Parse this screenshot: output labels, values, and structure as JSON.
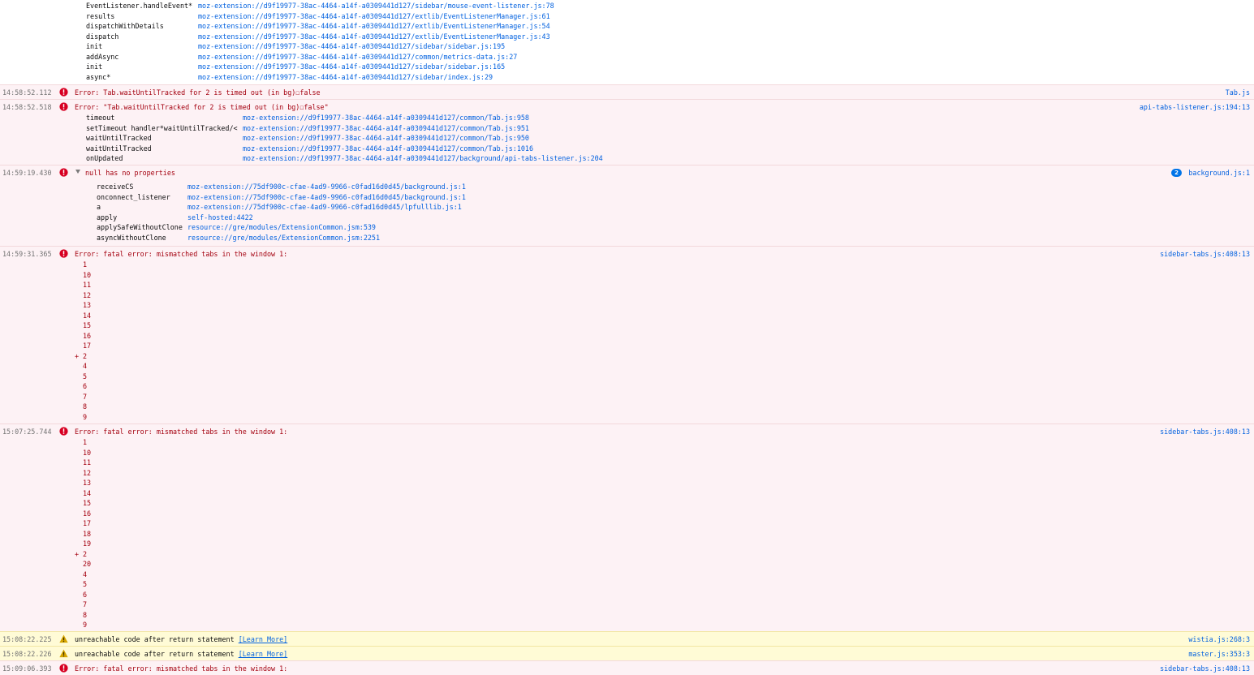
{
  "colors": {
    "error_bg": "#fdf2f5",
    "warning_bg": "#fffbd6",
    "error_text": "#a4000f",
    "link": "#0060df",
    "timestamp": "#737373",
    "badge": "#0074e8"
  },
  "icons": {
    "error": "error-circle-icon",
    "warning": "warning-triangle-icon",
    "expand": "twisty-expanded-icon"
  },
  "top_stack": [
    {
      "fn": "EventListener.handleEvent*",
      "loc": "moz-extension://d9f19977-38ac-4464-a14f-a0309441d127/sidebar/mouse-event-listener.js:78"
    },
    {
      "fn": "results",
      "loc": "moz-extension://d9f19977-38ac-4464-a14f-a0309441d127/extlib/EventListenerManager.js:61"
    },
    {
      "fn": "dispatchWithDetails",
      "loc": "moz-extension://d9f19977-38ac-4464-a14f-a0309441d127/extlib/EventListenerManager.js:54"
    },
    {
      "fn": "dispatch",
      "loc": "moz-extension://d9f19977-38ac-4464-a14f-a0309441d127/extlib/EventListenerManager.js:43"
    },
    {
      "fn": "init",
      "loc": "moz-extension://d9f19977-38ac-4464-a14f-a0309441d127/sidebar/sidebar.js:195"
    },
    {
      "fn": "addAsync",
      "loc": "moz-extension://d9f19977-38ac-4464-a14f-a0309441d127/common/metrics-data.js:27"
    },
    {
      "fn": "init",
      "loc": "moz-extension://d9f19977-38ac-4464-a14f-a0309441d127/sidebar/sidebar.js:165"
    },
    {
      "fn": "async*",
      "loc": "moz-extension://d9f19977-38ac-4464-a14f-a0309441d127/sidebar/index.js:29"
    }
  ],
  "messages": [
    {
      "time": "14:58:52.112",
      "text": "Error: Tab.waitUntilTracked for 2 is timed out (in bg)☐false",
      "source": "Tab.js"
    },
    {
      "time": "14:58:52.518",
      "text": "Error: \"Tab.waitUntilTracked for 2 is timed out (in bg)☐false\"",
      "source": "api-tabs-listener.js:194:13",
      "stack": [
        {
          "fn": "timeout",
          "loc": "moz-extension://d9f19977-38ac-4464-a14f-a0309441d127/common/Tab.js:958"
        },
        {
          "fn": "setTimeout handler*waitUntilTracked/<",
          "loc": "moz-extension://d9f19977-38ac-4464-a14f-a0309441d127/common/Tab.js:951"
        },
        {
          "fn": "waitUntilTracked",
          "loc": "moz-extension://d9f19977-38ac-4464-a14f-a0309441d127/common/Tab.js:950"
        },
        {
          "fn": "waitUntilTracked",
          "loc": "moz-extension://d9f19977-38ac-4464-a14f-a0309441d127/common/Tab.js:1016"
        },
        {
          "fn": "onUpdated",
          "loc": "moz-extension://d9f19977-38ac-4464-a14f-a0309441d127/background/api-tabs-listener.js:204"
        }
      ]
    },
    {
      "time": "14:59:19.430",
      "text": "null has no properties",
      "source": "background.js:1",
      "count": "2",
      "stack": [
        {
          "fn": "receiveCS",
          "loc": "moz-extension://75df900c-cfae-4ad9-9966-c0fad16d0d45/background.js:1"
        },
        {
          "fn": "onconnect_listener",
          "loc": "moz-extension://75df900c-cfae-4ad9-9966-c0fad16d0d45/background.js:1"
        },
        {
          "fn": "a",
          "loc": "moz-extension://75df900c-cfae-4ad9-9966-c0fad16d0d45/lpfulllib.js:1"
        },
        {
          "fn": "apply",
          "loc": "self-hosted:4422"
        },
        {
          "fn": "applySafeWithoutClone",
          "loc": "resource://gre/modules/ExtensionCommon.jsm:539"
        },
        {
          "fn": "asyncWithoutClone",
          "loc": "resource://gre/modules/ExtensionCommon.jsm:2251"
        }
      ]
    },
    {
      "time": "14:59:31.365",
      "text": "Error: fatal error: mismatched tabs in the window 1:",
      "source": "sidebar-tabs.js:408:13",
      "lines": [
        "1",
        "10",
        "11",
        "12",
        "13",
        "14",
        "15",
        "16",
        "17",
        "2",
        "4",
        "5",
        "6",
        "7",
        "8",
        "9"
      ],
      "plus_index": 9
    },
    {
      "time": "15:07:25.744",
      "text": "Error: fatal error: mismatched tabs in the window 1:",
      "source": "sidebar-tabs.js:408:13",
      "lines": [
        "1",
        "10",
        "11",
        "12",
        "13",
        "14",
        "15",
        "16",
        "17",
        "18",
        "19",
        "2",
        "20",
        "4",
        "5",
        "6",
        "7",
        "8",
        "9"
      ],
      "plus_index": 11
    },
    {
      "time": "15:08:22.225",
      "text": "unreachable code after return statement ",
      "link": "[Learn More]",
      "source": "wistia.js:268:3"
    },
    {
      "time": "15:08:22.226",
      "text": "unreachable code after return statement ",
      "link": "[Learn More]",
      "source": "master.js:353:3"
    },
    {
      "time": "15:09:06.393",
      "text": "Error: fatal error: mismatched tabs in the window 1:",
      "source": "sidebar-tabs.js:408:13"
    }
  ]
}
